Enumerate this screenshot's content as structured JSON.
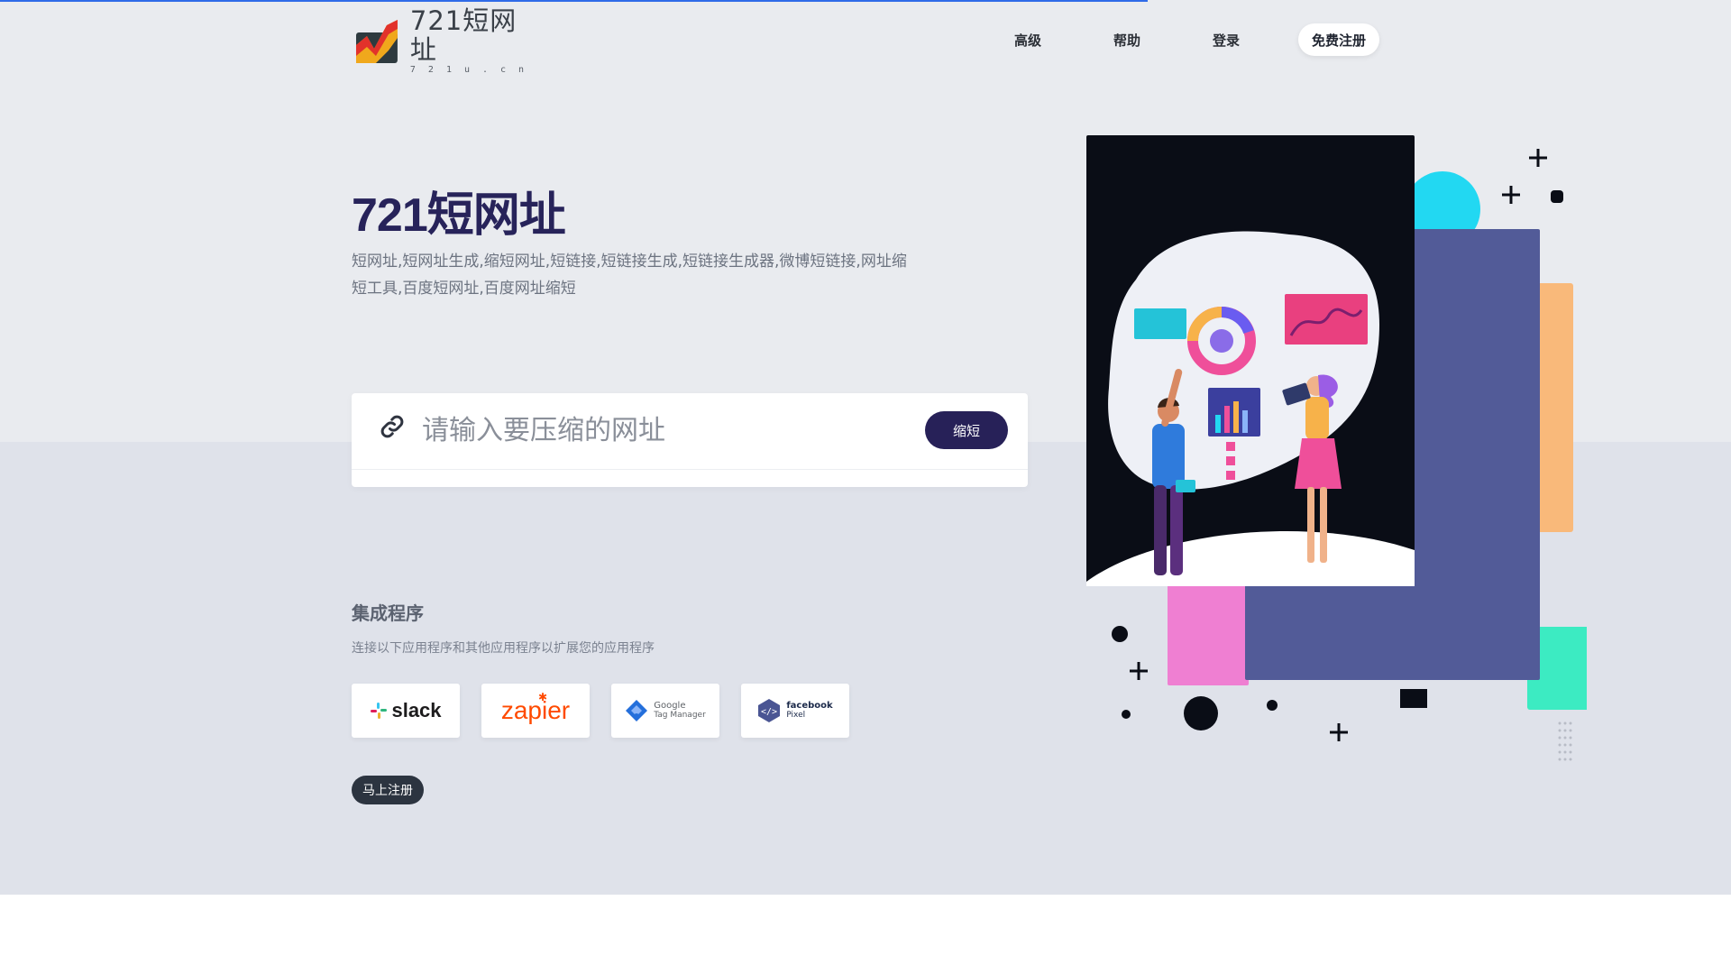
{
  "header": {
    "logo_title": "721短网址",
    "logo_sub": "721u.cn",
    "nav": [
      "高级",
      "帮助",
      "登录"
    ],
    "register_label": "免费注册"
  },
  "hero": {
    "title": "721短网址",
    "description": "短网址,短网址生成,缩短网址,短链接,短链接生成,短链接生成器,微博短链接,网址缩短工具,百度短网址,百度网址缩短"
  },
  "shorten": {
    "placeholder": "请输入要压缩的网址",
    "button_label": "缩短"
  },
  "integrations": {
    "title": "集成程序",
    "description": "连接以下应用程序和其他应用程序以扩展您的应用程序",
    "items": [
      {
        "name": "slack",
        "label": "slack"
      },
      {
        "name": "zapier",
        "label": "zapier"
      },
      {
        "name": "google-tag-manager",
        "label_top": "Google",
        "label_bottom": "Tag Manager"
      },
      {
        "name": "facebook-pixel",
        "label_top": "facebook",
        "label_bottom": "Pixel"
      }
    ],
    "signup_label": "马上注册"
  },
  "colors": {
    "accent": "#272158",
    "progress": "#2f6be8",
    "background_top": "#e9ebef",
    "background_bottom": "#dfe2ea"
  }
}
